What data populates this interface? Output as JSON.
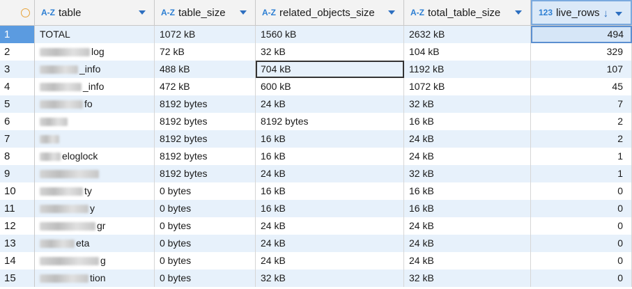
{
  "columns": [
    {
      "type": "A-Z",
      "name": "table"
    },
    {
      "type": "A-Z",
      "name": "table_size"
    },
    {
      "type": "A-Z",
      "name": "related_objects_size"
    },
    {
      "type": "A-Z",
      "name": "total_table_size"
    },
    {
      "type": "123",
      "name": "live_rows",
      "sorted": "desc"
    }
  ],
  "rows": [
    {
      "n": "1",
      "table": "TOTAL",
      "table_size": "1072 kB",
      "related": "1560 kB",
      "total": "2632 kB",
      "live": "494"
    },
    {
      "n": "2",
      "table": "log",
      "table_size": "72 kB",
      "related": "32 kB",
      "total": "104 kB",
      "live": "329"
    },
    {
      "n": "3",
      "table": "_info",
      "table_size": "488 kB",
      "related": "704 kB",
      "total": "1192 kB",
      "live": "107"
    },
    {
      "n": "4",
      "table": "_info",
      "table_size": "472 kB",
      "related": "600 kB",
      "total": "1072 kB",
      "live": "45"
    },
    {
      "n": "5",
      "table": "fo",
      "table_size": "8192 bytes",
      "related": "24 kB",
      "total": "32 kB",
      "live": "7"
    },
    {
      "n": "6",
      "table": "",
      "table_size": "8192 bytes",
      "related": "8192 bytes",
      "total": "16 kB",
      "live": "2"
    },
    {
      "n": "7",
      "table": "",
      "table_size": "8192 bytes",
      "related": "16 kB",
      "total": "24 kB",
      "live": "2"
    },
    {
      "n": "8",
      "table": "eloglock",
      "table_size": "8192 bytes",
      "related": "16 kB",
      "total": "24 kB",
      "live": "1"
    },
    {
      "n": "9",
      "table": "",
      "table_size": "8192 bytes",
      "related": "24 kB",
      "total": "32 kB",
      "live": "1"
    },
    {
      "n": "10",
      "table": "ty",
      "table_size": "0 bytes",
      "related": "16 kB",
      "total": "16 kB",
      "live": "0"
    },
    {
      "n": "11",
      "table": "y",
      "table_size": "0 bytes",
      "related": "16 kB",
      "total": "16 kB",
      "live": "0"
    },
    {
      "n": "12",
      "table": "gr",
      "table_size": "0 bytes",
      "related": "24 kB",
      "total": "24 kB",
      "live": "0"
    },
    {
      "n": "13",
      "table": "eta",
      "table_size": "0 bytes",
      "related": "24 kB",
      "total": "24 kB",
      "live": "0"
    },
    {
      "n": "14",
      "table": "g",
      "table_size": "0 bytes",
      "related": "24 kB",
      "total": "24 kB",
      "live": "0"
    },
    {
      "n": "15",
      "table": "tion",
      "table_size": "0 bytes",
      "related": "32 kB",
      "total": "32 kB",
      "live": "0"
    }
  ],
  "colors": {
    "accent": "#2d7fd3",
    "alt_row": "#e7f1fb"
  }
}
